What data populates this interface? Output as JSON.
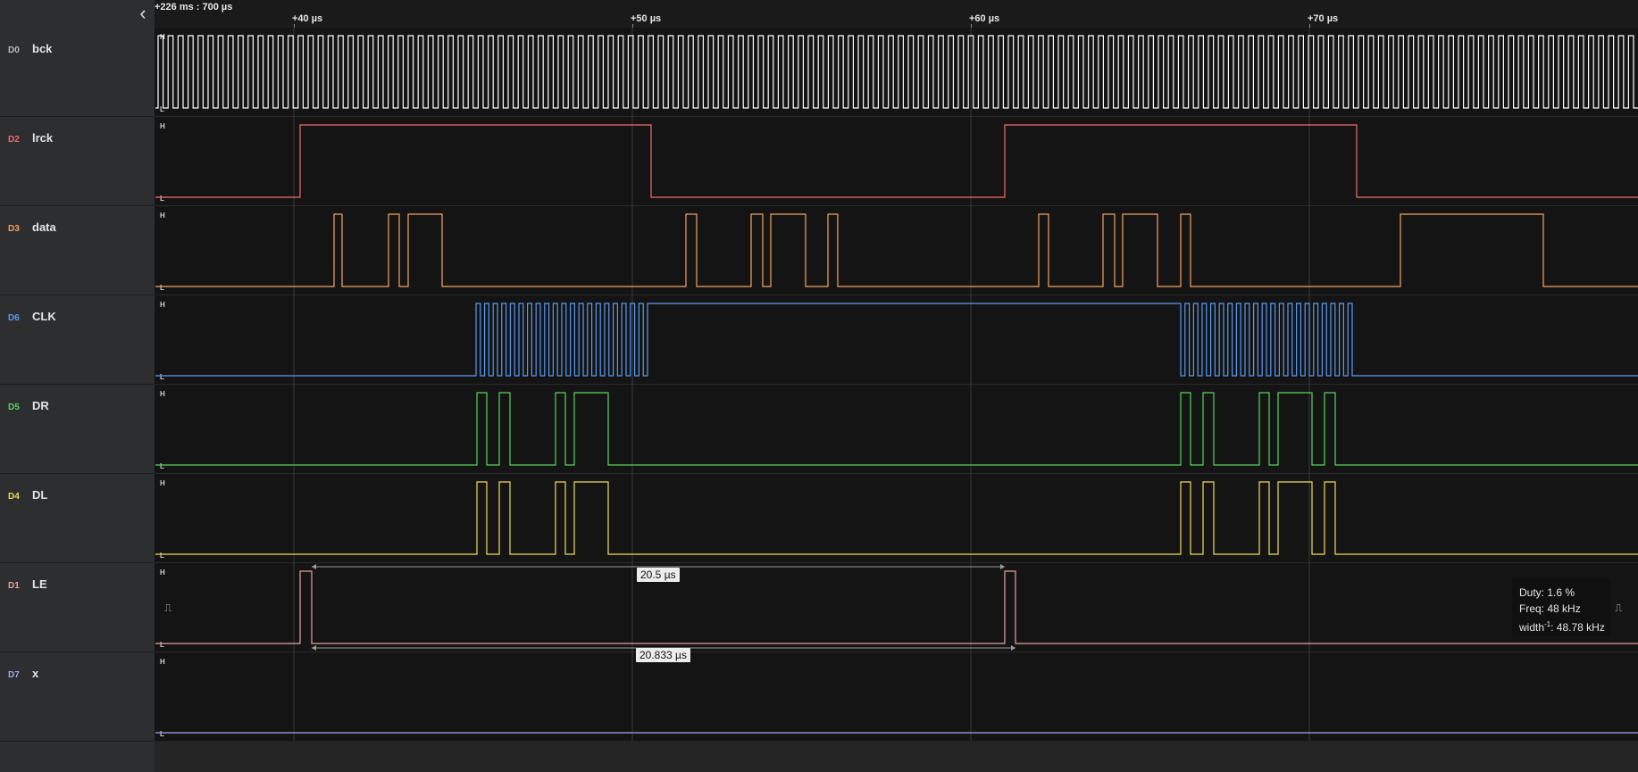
{
  "timeline": {
    "absolute_time": "+226 ms : 700 µs",
    "ticks": [
      {
        "label": "+40 µs",
        "t": 40
      },
      {
        "label": "+50 µs",
        "t": 50
      },
      {
        "label": "+60 µs",
        "t": 60
      },
      {
        "label": "+70 µs",
        "t": 70
      }
    ]
  },
  "channels": [
    {
      "code": "D0",
      "name": "bck",
      "color": "#ffffff",
      "code_color": "#bdbdbd"
    },
    {
      "code": "D2",
      "name": "lrck",
      "color": "#ef6b6b",
      "code_color": "#ef6b6b"
    },
    {
      "code": "D3",
      "name": "data",
      "color": "#f2a561",
      "code_color": "#f2a561"
    },
    {
      "code": "D6",
      "name": "CLK",
      "color": "#5c9bf0",
      "code_color": "#5c9bf0"
    },
    {
      "code": "D5",
      "name": "DR",
      "color": "#58d45e",
      "code_color": "#58d45e"
    },
    {
      "code": "D4",
      "name": "DL",
      "color": "#f1dc5b",
      "code_color": "#f1dc5b"
    },
    {
      "code": "D1",
      "name": "LE",
      "color": "#e8a0a0",
      "code_color": "#e8a0a0"
    },
    {
      "code": "D7",
      "name": "x",
      "color": "#a2a6f2",
      "code_color": "#a2a6f2"
    }
  ],
  "level_labels": {
    "high": "H",
    "low": "L"
  },
  "measurements": {
    "upper_label": "20.5 µs",
    "lower_label": "20.833 µs",
    "tooltip": {
      "duty": "Duty: 1.6 %",
      "freq": "Freq: 48 kHz",
      "width_prefix": "width",
      "width_sup": "-1",
      "width_value": ": 48.78 kHz"
    }
  },
  "icons": {
    "collapse": "chevron-left-icon",
    "edge_left": "falling-edge-icon",
    "edge_right": "rising-edge-icon"
  }
}
